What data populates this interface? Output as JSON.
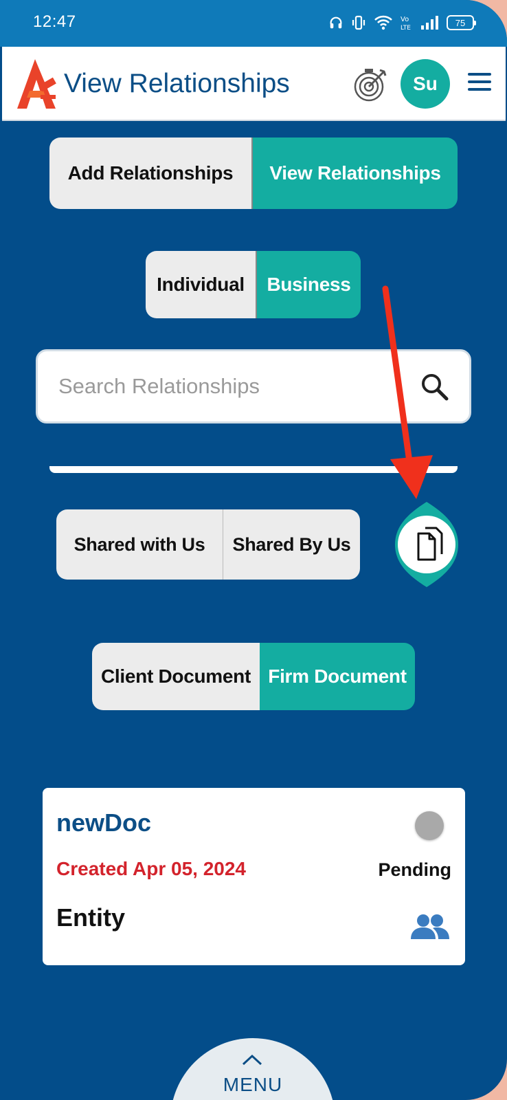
{
  "status_bar": {
    "time": "12:47",
    "battery": "75",
    "icons": [
      "headphones-icon",
      "vibrate-icon",
      "wifi-icon",
      "volte-icon",
      "signal-icon",
      "battery-icon"
    ]
  },
  "header": {
    "title": "View Relationships",
    "avatar_initials": "Su",
    "icons": [
      "app-logo",
      "goal-target-icon",
      "hamburger-menu-icon"
    ]
  },
  "relationship_tabs": {
    "add": "Add Relationships",
    "view": "View Relationships",
    "active": "view"
  },
  "type_tabs": {
    "individual": "Individual",
    "business": "Business",
    "active": "business"
  },
  "search": {
    "placeholder": "Search Relationships",
    "value": ""
  },
  "share_tabs": {
    "shared_with_us": "Shared with Us",
    "shared_by_us": "Shared By Us"
  },
  "document_tabs": {
    "client": "Client Document",
    "firm": "Firm Document",
    "active": "firm"
  },
  "documents": [
    {
      "name": "newDoc",
      "created": "Created Apr 05, 2024",
      "type": "Entity",
      "status": "Pending"
    }
  ],
  "menu": {
    "label": "MENU"
  },
  "colors": {
    "background": "#034d8a",
    "accent": "#14ada1",
    "primary_text": "#0c4e86",
    "date_red": "#d3232c",
    "annotation_arrow": "#f0301c"
  }
}
